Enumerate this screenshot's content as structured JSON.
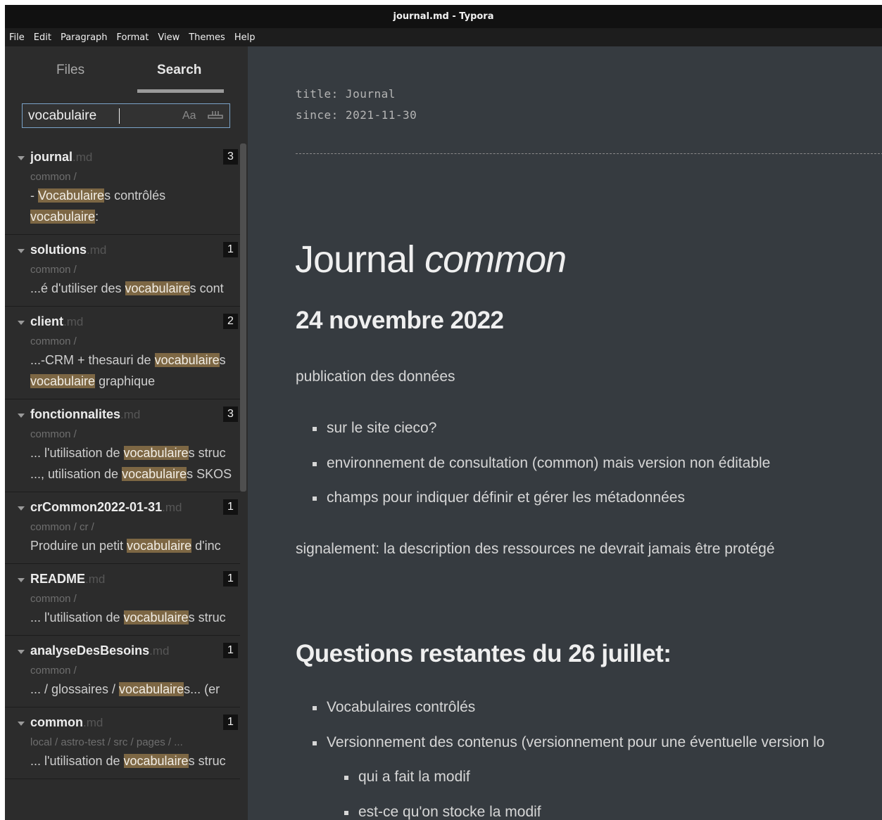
{
  "window": {
    "title": "journal.md - Typora"
  },
  "menu": [
    "File",
    "Edit",
    "Paragraph",
    "Format",
    "View",
    "Themes",
    "Help"
  ],
  "sidebar": {
    "tabs": {
      "files": "Files",
      "search": "Search"
    },
    "search": {
      "query": "vocabulaire",
      "case_toggle": "Aa",
      "regex_icon": "whole-word-icon"
    },
    "results": [
      {
        "name": "journal",
        "ext": ".md",
        "count": "3",
        "path": "common /",
        "snippets": [
          [
            {
              "t": "- "
            },
            {
              "t": "Vocabulaire",
              "m": true
            },
            {
              "t": "s contrôlés"
            }
          ],
          [
            {
              "t": "vocabulaire",
              "m": true
            },
            {
              "t": ":"
            }
          ]
        ]
      },
      {
        "name": "solutions",
        "ext": ".md",
        "count": "1",
        "path": "common /",
        "snippets": [
          [
            {
              "t": "...é d'utiliser des "
            },
            {
              "t": "vocabulaire",
              "m": true
            },
            {
              "t": "s cont"
            }
          ]
        ]
      },
      {
        "name": "client",
        "ext": ".md",
        "count": "2",
        "path": "common /",
        "snippets": [
          [
            {
              "t": "...-CRM + thesauri de "
            },
            {
              "t": "vocabulaire",
              "m": true
            },
            {
              "t": "s"
            }
          ],
          [
            {
              "t": "vocabulaire",
              "m": true
            },
            {
              "t": " graphique"
            }
          ]
        ]
      },
      {
        "name": "fonctionnalites",
        "ext": ".md",
        "count": "3",
        "path": "common /",
        "snippets": [
          [
            {
              "t": "... l'utilisation de "
            },
            {
              "t": "vocabulaire",
              "m": true
            },
            {
              "t": "s struc"
            }
          ],
          [
            {
              "t": "..., utilisation de "
            },
            {
              "t": "vocabulaire",
              "m": true
            },
            {
              "t": "s SKOS"
            }
          ]
        ]
      },
      {
        "name": "crCommon2022-01-31",
        "ext": ".md",
        "count": "1",
        "path": "common / cr /",
        "snippets": [
          [
            {
              "t": "Produire un petit "
            },
            {
              "t": "vocabulaire",
              "m": true
            },
            {
              "t": " d'inc"
            }
          ]
        ]
      },
      {
        "name": "README",
        "ext": ".md",
        "count": "1",
        "path": "common /",
        "snippets": [
          [
            {
              "t": "... l'utilisation de "
            },
            {
              "t": "vocabulaire",
              "m": true
            },
            {
              "t": "s struc"
            }
          ]
        ]
      },
      {
        "name": "analyseDesBesoins",
        "ext": ".md",
        "count": "1",
        "path": "common /",
        "snippets": [
          [
            {
              "t": "... / glossaires / "
            },
            {
              "t": "vocabulaire",
              "m": true
            },
            {
              "t": "s... (er"
            }
          ]
        ]
      },
      {
        "name": "common",
        "ext": ".md",
        "count": "1",
        "path": "local / astro-test / src / pages / ...",
        "snippets": [
          [
            {
              "t": "... l'utilisation de "
            },
            {
              "t": "vocabulaire",
              "m": true
            },
            {
              "t": "s struc"
            }
          ]
        ]
      }
    ]
  },
  "editor": {
    "frontmatter": {
      "title_line": "title: Journal",
      "since_line": "since: 2021-11-30"
    },
    "h1": {
      "plain": "Journal ",
      "italic": "common"
    },
    "section1": {
      "heading": "24 novembre 2022",
      "intro": "publication des données",
      "bullets": [
        "sur le site cieco?",
        "environnement de consultation (common) mais version non éditable",
        "champs pour indiquer définir et gérer les métadonnées"
      ],
      "note": "signalement: la description des ressources ne devrait jamais être protégé"
    },
    "section2": {
      "heading": "Questions restantes du 26 juillet:",
      "bullets": [
        "Vocabulaires contrôlés",
        "Versionnement des contenus (versionnement pour une éventuelle version lo"
      ],
      "subbullets": [
        "qui a fait la modif",
        "est-ce qu'on stocke la modif"
      ]
    }
  }
}
